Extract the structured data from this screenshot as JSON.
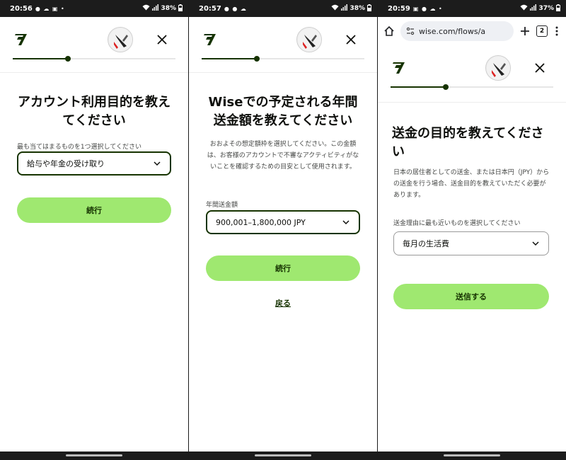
{
  "colors": {
    "brand_dark": "#163300",
    "button_green": "#9fe870",
    "status_bar": "#1c1c1c"
  },
  "panels": [
    {
      "status": {
        "time": "20:56",
        "battery": "38%"
      },
      "header": {
        "logo_icon": "wise-logo-icon",
        "avatar_icon": "avatar",
        "close_icon": "close-icon",
        "progress": 0.34
      },
      "title": "アカウント利用目的を教えてください",
      "field_label": "最も当てはまるものを1つ選択してください",
      "select_value": "給与や年金の受け取り",
      "primary_button": "続行"
    },
    {
      "status": {
        "time": "20:57",
        "battery": "38%"
      },
      "header": {
        "logo_icon": "wise-logo-icon",
        "avatar_icon": "avatar",
        "close_icon": "close-icon",
        "progress": 0.34
      },
      "title": "Wiseでの予定される年間送金額を教えてください",
      "description": "おおよその想定額枠を選択してください。この金額は、お客様のアカウントで不審なアクティビティがないことを確認するための目安として使用されます。",
      "field_label": "年間送金額",
      "select_value": "900,001–1,800,000 JPY",
      "primary_button": "続行",
      "back_link": "戻る"
    },
    {
      "status": {
        "time": "20:59",
        "battery": "37%"
      },
      "browser": {
        "url": "wise.com/flows/a",
        "tab_count": "2"
      },
      "header": {
        "logo_icon": "wise-logo-icon",
        "avatar_icon": "avatar",
        "close_icon": "close-icon",
        "progress": 0.34
      },
      "title": "送金の目的を教えてください",
      "description": "日本の居住者としての送金、または日本円（JPY）からの送金を行う場合、送金目的を教えていただく必要があります。",
      "field_label": "送金理由に最も近いものを選択してください",
      "select_value": "毎月の生活費",
      "primary_button": "送信する"
    }
  ]
}
